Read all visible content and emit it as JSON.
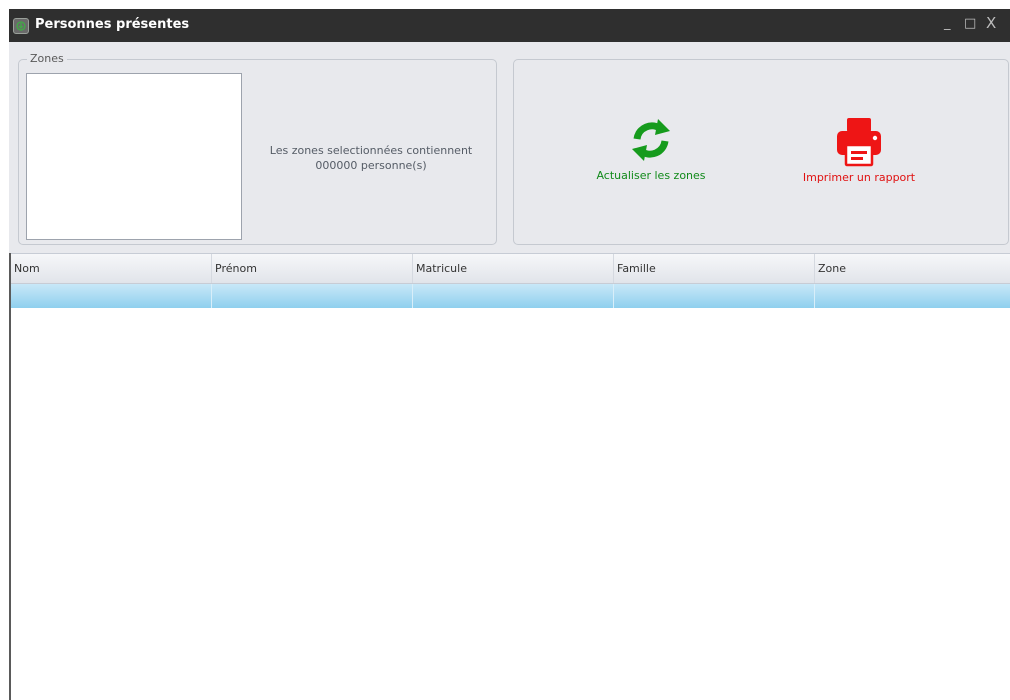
{
  "window": {
    "title": "Personnes présentes",
    "minimize": "_",
    "maximize": "□",
    "close": "X"
  },
  "zones_panel": {
    "legend": "Zones",
    "info_line1": "Les zones selectionnées contiennent",
    "info_line2": "000000 personne(s)"
  },
  "actions": {
    "refresh_label": "Actualiser les zones",
    "refresh_icon": "refresh-icon",
    "refresh_color": "#118a1a",
    "print_label": "Imprimer un rapport",
    "print_icon": "printer-icon",
    "print_color": "#e01111"
  },
  "grid": {
    "columns": [
      "Nom",
      "Prénom",
      "Matricule",
      "Famille",
      "Zone"
    ],
    "selected_row_color": "#8fd0ee"
  }
}
